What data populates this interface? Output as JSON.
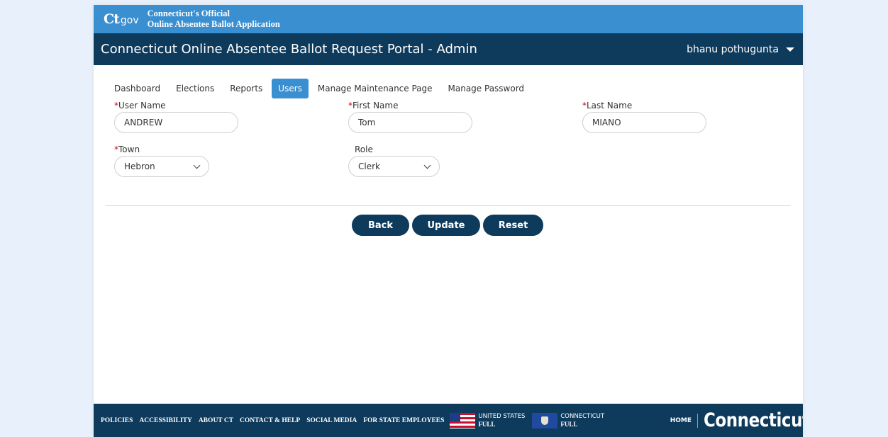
{
  "brand": {
    "logo_main": "Ct",
    "logo_sub": "gov",
    "line1": "Connecticut's Official",
    "line2": "Online Absentee Ballot Application"
  },
  "header": {
    "title": "Connecticut Online Absentee Ballot Request Portal - Admin",
    "user_name": "bhanu pothugunta"
  },
  "tabs": [
    {
      "label": "Dashboard",
      "active": false
    },
    {
      "label": "Elections",
      "active": false
    },
    {
      "label": "Reports",
      "active": false
    },
    {
      "label": "Users",
      "active": true
    },
    {
      "label": "Manage Maintenance Page",
      "active": false
    },
    {
      "label": "Manage Password",
      "active": false
    }
  ],
  "form": {
    "user_name": {
      "required": "*",
      "label": "User Name",
      "value": "ANDREW"
    },
    "first_name": {
      "required": "*",
      "label": "First Name",
      "value": "Tom"
    },
    "last_name": {
      "required": "*",
      "label": "Last Name",
      "value": "MIANO"
    },
    "town": {
      "required": "*",
      "label": "Town",
      "value": "Hebron"
    },
    "role": {
      "label": "Role",
      "value": "Clerk"
    }
  },
  "actions": {
    "back": "Back",
    "update": "Update",
    "reset": "Reset"
  },
  "footer": {
    "links": [
      "POLICIES",
      "ACCESSIBILITY",
      "ABOUT CT",
      "CONTACT & HELP",
      "SOCIAL MEDIA",
      "FOR STATE EMPLOYEES"
    ],
    "us_flag": {
      "line1": "UNITED STATES",
      "line2": "FULL"
    },
    "ct_flag": {
      "line1": "CONNECTICUT",
      "line2": "FULL"
    },
    "home": "HOME",
    "wordmark": "Connecticut"
  },
  "colors": {
    "navy": "#0e3a5c",
    "blue": "#3a8fd1",
    "required": "#d0021b",
    "background": "#e8f1fb"
  }
}
